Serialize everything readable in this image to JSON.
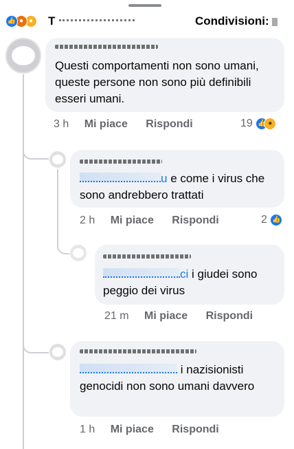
{
  "header": {
    "reaction_icons": [
      "like-icon",
      "angry-icon",
      "sad-icon"
    ],
    "names_prefix": "T",
    "shares_label": "Condivisioni:"
  },
  "colors": {
    "accent": "#1877f2",
    "bubble_bg": "#f0f2f5",
    "meta_text": "#65676b",
    "thread_line": "#ccd0d5"
  },
  "comments": [
    {
      "text": "Questi comportamenti non sono umani, queste persone non sono più definibili esseri umani.",
      "time": "3 h",
      "like_label": "Mi piace",
      "reply_label": "Rispondi",
      "reaction_count": "19",
      "reaction_icons": [
        "like-icon",
        "haha-icon"
      ]
    },
    {
      "mention_tail": "u",
      "text": "e come i virus che sono andrebbero trattati",
      "time": "2 h",
      "like_label": "Mi piace",
      "reply_label": "Rispondi",
      "reaction_count": "2",
      "reaction_icons": [
        "like-icon"
      ]
    },
    {
      "mention_tail": "ci",
      "text": "i giudei sono peggio dei virus",
      "time": "21 m",
      "like_label": "Mi piace",
      "reply_label": "Rispondi"
    },
    {
      "text": "i nazisionisti genocidi non sono umani davvero",
      "time": "1 h",
      "like_label": "Mi piace",
      "reply_label": "Rispondi"
    }
  ]
}
